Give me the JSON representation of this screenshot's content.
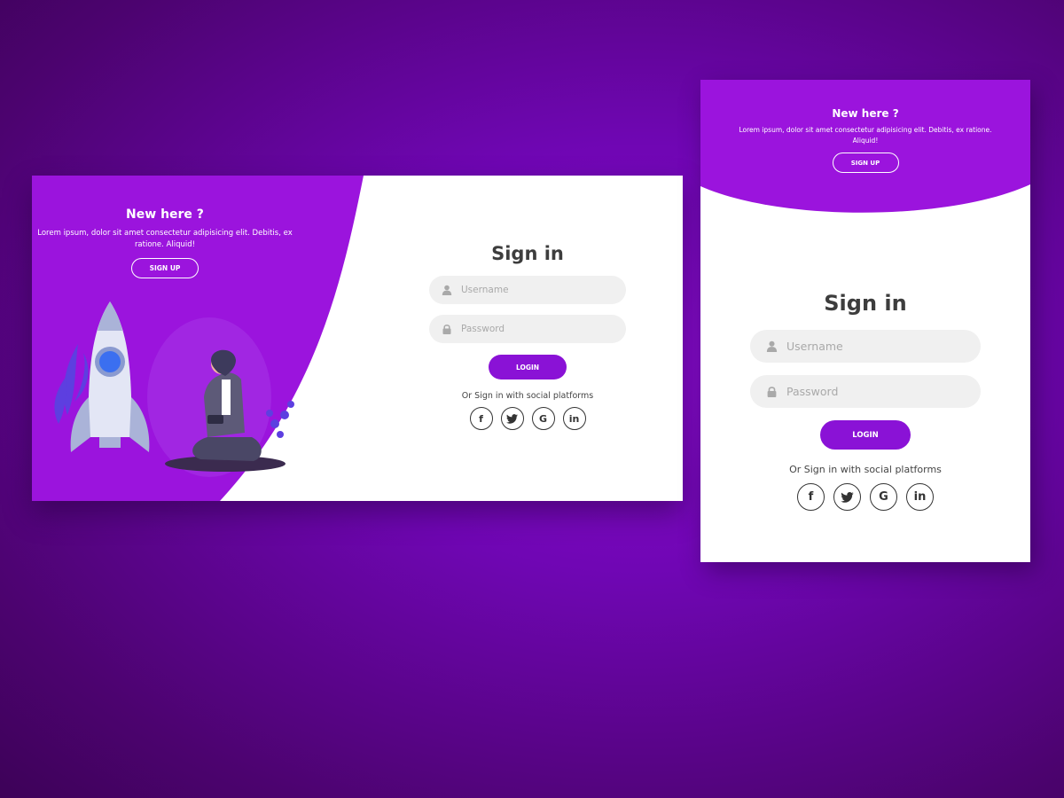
{
  "colors": {
    "background": "#6f06b3",
    "panel": "#9b14dd",
    "accent": "#8a12d6",
    "field": "#f0f0f0",
    "title_text": "#3d3d3d"
  },
  "desktop": {
    "panel": {
      "title": "New here ?",
      "description": "Lorem ipsum, dolor sit amet consectetur adipisicing elit. Debitis, ex ratione. Aliquid!",
      "signup_label": "SIGN UP"
    },
    "form": {
      "title": "Sign in",
      "username_placeholder": "Username",
      "password_placeholder": "Password",
      "login_label": "LOGIN",
      "social_text": "Or Sign in with social platforms",
      "socials": [
        {
          "icon": "facebook-icon",
          "glyph": "f"
        },
        {
          "icon": "twitter-icon",
          "glyph": "🐦"
        },
        {
          "icon": "google-icon",
          "glyph": "G"
        },
        {
          "icon": "linkedin-icon",
          "glyph": "in"
        }
      ]
    }
  },
  "mobile": {
    "panel": {
      "title": "New here ?",
      "description": "Lorem ipsum, dolor sit amet consectetur adipisicing elit. Debitis, ex ratione. Aliquid!",
      "signup_label": "SIGN UP"
    },
    "form": {
      "title": "Sign in",
      "username_placeholder": "Username",
      "password_placeholder": "Password",
      "login_label": "LOGIN",
      "social_text": "Or Sign in with social platforms",
      "socials": [
        {
          "icon": "facebook-icon",
          "glyph": "f"
        },
        {
          "icon": "twitter-icon",
          "glyph": "🐦"
        },
        {
          "icon": "google-icon",
          "glyph": "G"
        },
        {
          "icon": "linkedin-icon",
          "glyph": "in"
        }
      ]
    }
  }
}
